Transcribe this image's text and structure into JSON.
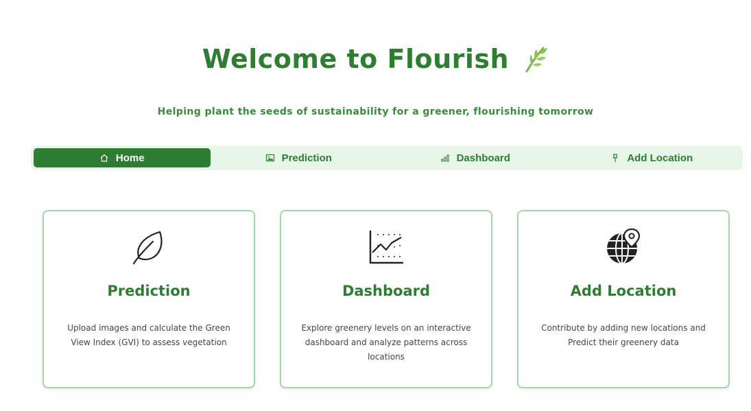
{
  "header": {
    "title": "Welcome to Flourish",
    "subtitle": "Helping plant the seeds of sustainability for a greener, flourishing tomorrow"
  },
  "tabs": [
    {
      "label": "Home",
      "icon": "home-icon",
      "active": true
    },
    {
      "label": "Prediction",
      "icon": "image-icon",
      "active": false
    },
    {
      "label": "Dashboard",
      "icon": "bar-chart-icon",
      "active": false
    },
    {
      "label": "Add Location",
      "icon": "pin-icon",
      "active": false
    }
  ],
  "cards": [
    {
      "title": "Prediction",
      "icon": "leaf-icon",
      "description": "Upload images and calculate the Green View Index (GVI) to assess vegetation"
    },
    {
      "title": "Dashboard",
      "icon": "chart-icon",
      "description": "Explore greenery levels on an interactive dashboard and analyze patterns across locations"
    },
    {
      "title": "Add Location",
      "icon": "globe-pin-icon",
      "description": "Contribute by adding new locations and Predict their greenery data"
    }
  ],
  "colors": {
    "primary": "#2e7d32",
    "tab_bg": "#e8f5e9",
    "card_border": "#a5d6a7"
  }
}
